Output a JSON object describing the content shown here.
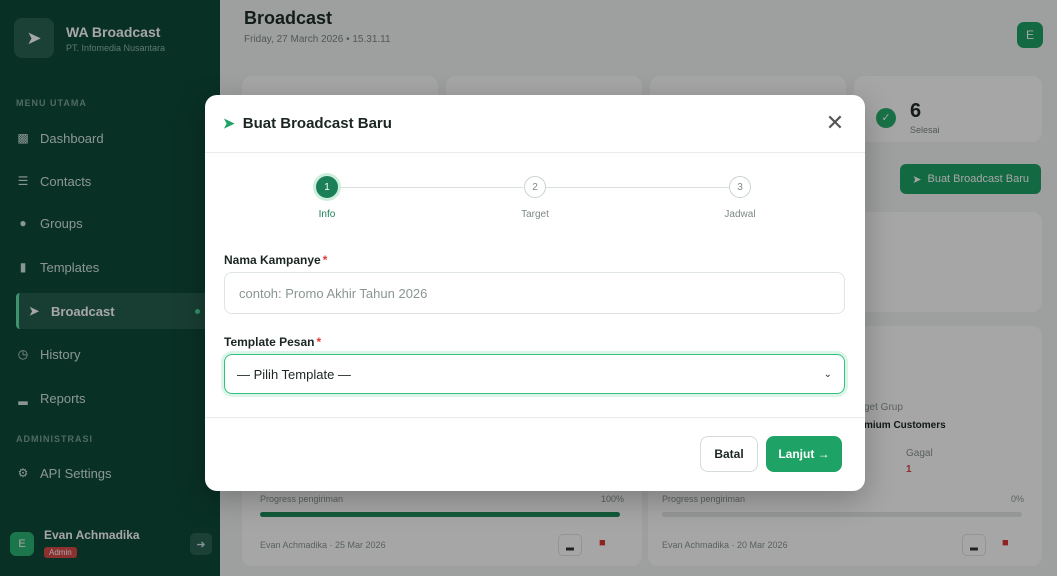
{
  "sidebar": {
    "brand_title": "WA Broadcast",
    "brand_sub": "PT. Infomedia Nusantara",
    "section_main": "MENU UTAMA",
    "section_admin": "ADMINISTRASI",
    "items": [
      {
        "label": "Dashboard",
        "icon": "dashboard-icon"
      },
      {
        "label": "Contacts",
        "icon": "contacts-icon"
      },
      {
        "label": "Groups",
        "icon": "groups-icon"
      },
      {
        "label": "Templates",
        "icon": "document-icon"
      },
      {
        "label": "Broadcast",
        "icon": "send-icon",
        "active": true
      },
      {
        "label": "History",
        "icon": "history-icon"
      },
      {
        "label": "Reports",
        "icon": "bar-chart-icon"
      }
    ],
    "admin_items": [
      {
        "label": "API Settings",
        "icon": "gear-icon"
      }
    ],
    "user": {
      "initial": "E",
      "name": "Evan Achmadika",
      "role": "Admin"
    }
  },
  "header": {
    "title": "Broadcast",
    "date": "Friday, 27 March 2026 • 15.31.11",
    "avatar_initial": "E"
  },
  "stats": {
    "done_value": "6",
    "done_label": "Selesai"
  },
  "new_broadcast_button": "Buat Broadcast Baru",
  "background_cards": {
    "target_group_label": "get Grup",
    "target_group_value": "mium Customers",
    "failed_label": "Gagal",
    "failed_value": "1",
    "card1": {
      "progress_label": "Progress pengiriman",
      "progress_pct": "100%",
      "progress": 1.0,
      "meta": "Evan Achmadika · 25 Mar 2026"
    },
    "card2": {
      "progress_label": "Progress pengiriman",
      "progress_pct": "0%",
      "progress": 0.0,
      "meta": "Evan Achmadika · 20 Mar 2026"
    }
  },
  "modal": {
    "title": "Buat Broadcast Baru",
    "steps": [
      {
        "number": "1",
        "label": "Info",
        "active": true
      },
      {
        "number": "2",
        "label": "Target",
        "active": false
      },
      {
        "number": "3",
        "label": "Jadwal",
        "active": false
      }
    ],
    "campaign_label": "Nama Kampanye",
    "campaign_placeholder": "contoh: Promo Akhir Tahun 2026",
    "template_label": "Template Pesan",
    "template_selected": "— Pilih Template —",
    "required_mark": "*",
    "cancel_label": "Batal",
    "next_label": "Lanjut →"
  },
  "colors": {
    "sidebar_bg": "#0f4a3a",
    "accent": "#1ea265",
    "danger": "#e03b3b"
  }
}
